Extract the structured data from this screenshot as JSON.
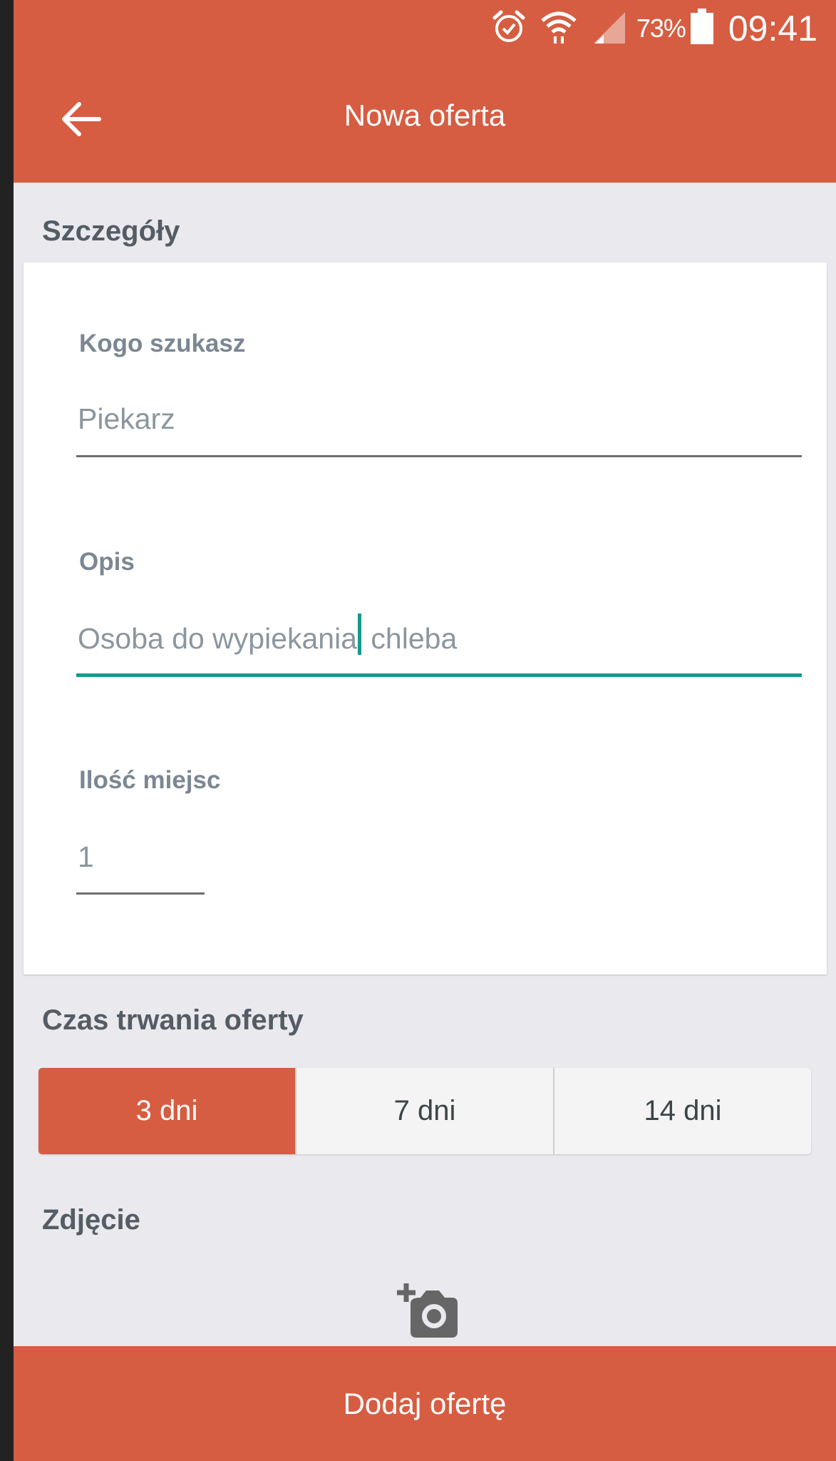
{
  "status_bar": {
    "battery_percent": "73%",
    "time": "09:41",
    "icons": [
      "alarm-icon",
      "wifi-icon",
      "signal-icon",
      "battery-icon"
    ]
  },
  "toolbar": {
    "title": "Nowa oferta",
    "back_icon": "arrow-back-icon"
  },
  "sections": {
    "details": "Szczegóły",
    "duration": "Czas trwania oferty",
    "photo": "Zdjęcie"
  },
  "form": {
    "who_label": "Kogo szukasz",
    "who_value": "Piekarz",
    "description_label": "Opis",
    "description_value_before_cursor": "Osoba do wypiekania",
    "description_value_after_cursor": " chleba",
    "places_label": "Ilość miejsc",
    "places_value": "1"
  },
  "duration_options": [
    "3 dni",
    "7 dni",
    "14 dni"
  ],
  "duration_selected": "3 dni",
  "photo": {
    "icon": "add-photo-icon"
  },
  "submit_label": "Dodaj ofertę",
  "colors": {
    "accent": "#d65d42",
    "focus": "#159b8a",
    "background": "#e9e9ee"
  }
}
